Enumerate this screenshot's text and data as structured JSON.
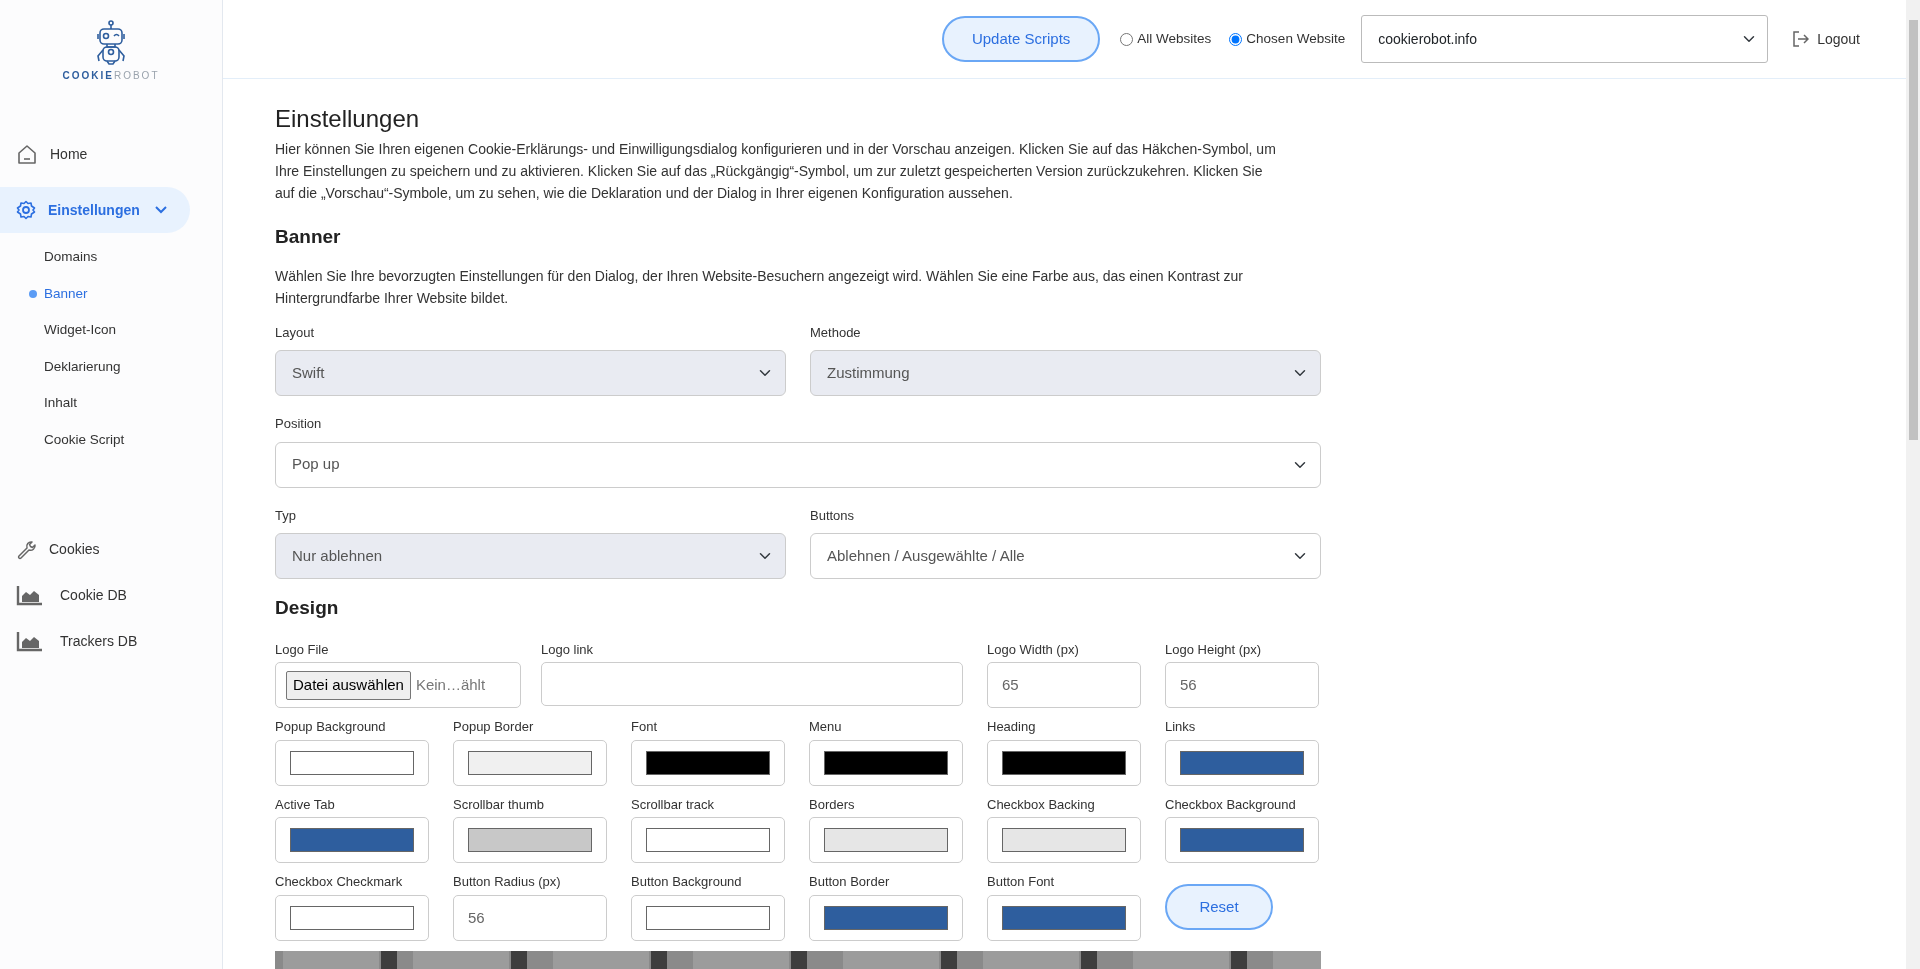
{
  "logo": {
    "bold_part": "COOKIE",
    "light_part": "ROBOT"
  },
  "sidebar": {
    "items": [
      {
        "label": "Home",
        "kind": "home",
        "selected": false
      },
      {
        "label": "Einstellungen",
        "kind": "settings",
        "selected": true,
        "expanded": true,
        "children": [
          {
            "label": "Domains",
            "selected": false
          },
          {
            "label": "Banner",
            "selected": true
          },
          {
            "label": "Widget-Icon",
            "selected": false
          },
          {
            "label": "Deklarierung",
            "selected": false
          },
          {
            "label": "Inhalt",
            "selected": false
          },
          {
            "label": "Cookie Script",
            "selected": false
          }
        ]
      },
      {
        "label": "Cookies",
        "kind": "wrench",
        "selected": false
      },
      {
        "label": "Cookie DB",
        "kind": "chart",
        "selected": false
      },
      {
        "label": "Trackers DB",
        "kind": "chart",
        "selected": false
      }
    ]
  },
  "topbar": {
    "update_button": "Update Scripts",
    "scope": [
      {
        "label": "All Websites",
        "selected": false
      },
      {
        "label": "Chosen Website",
        "selected": true
      }
    ],
    "website_select": {
      "value": "cookierobot.info"
    },
    "logout": "Logout"
  },
  "page": {
    "title": "Einstellungen",
    "intro": "Hier können Sie Ihren eigenen Cookie-Erklärungs- und Einwilligungsdialog konfigurieren und in der Vorschau anzeigen. Klicken Sie auf das Häkchen-Symbol, um Ihre Einstellungen zu speichern und zu aktivieren. Klicken Sie auf das „Rückgängig“-Symbol, um zur zuletzt gespeicherten Version zurückzukehren. Klicken Sie auf die „Vorschau“-Symbole, um zu sehen, wie die Deklaration und der Dialog in Ihrer eigenen Konfiguration aussehen.",
    "banner_heading": "Banner",
    "banner_text": "Wählen Sie Ihre bevorzugten Einstellungen für den Dialog, der Ihren Website-Besuchern angezeigt wird. Wählen Sie eine Farbe aus, das einen Kontrast zur Hintergrundfarbe Ihrer Website bildet.",
    "selects": [
      [
        {
          "label": "Layout",
          "value": "Swift",
          "disabled": true
        },
        {
          "label": "Methode",
          "value": "Zustimmung",
          "disabled": true
        }
      ],
      [
        {
          "label": "Position",
          "value": "Pop up",
          "disabled": false
        }
      ],
      [
        {
          "label": "Typ",
          "value": "Nur ablehnen",
          "disabled": true
        },
        {
          "label": "Buttons",
          "value": "Ablehnen / Ausgewählte / Alle",
          "disabled": false
        }
      ]
    ],
    "design_heading": "Design",
    "logo_file": {
      "label": "Logo File",
      "button": "Datei auswählen",
      "file_name": "Kein…ählt"
    },
    "logo_link": {
      "label": "Logo link"
    },
    "logo_size": [
      {
        "label": "Logo Width (px)",
        "value": "65"
      },
      {
        "label": "Logo Height (px)",
        "value": "56"
      }
    ],
    "design_fields": [
      {
        "label": "Popup Background",
        "kind": "color",
        "color": "#ffffff"
      },
      {
        "label": "Popup Border",
        "kind": "color",
        "color": "#f0f0f0"
      },
      {
        "label": "Font",
        "kind": "color",
        "color": "#000000"
      },
      {
        "label": "Menu",
        "kind": "color",
        "color": "#000000"
      },
      {
        "label": "Heading",
        "kind": "color",
        "color": "#000000"
      },
      {
        "label": "Links",
        "kind": "color",
        "color": "#2e5e9e"
      },
      {
        "label": "Active Tab",
        "kind": "color",
        "color": "#2e5e9e"
      },
      {
        "label": "Scrollbar thumb",
        "kind": "color",
        "color": "#c8c8c8"
      },
      {
        "label": "Scrollbar track",
        "kind": "color",
        "color": "#ffffff"
      },
      {
        "label": "Borders",
        "kind": "color",
        "color": "#e6e6e6"
      },
      {
        "label": "Checkbox Backing",
        "kind": "color",
        "color": "#e6e6e6"
      },
      {
        "label": "Checkbox Background",
        "kind": "color",
        "color": "#2e5e9e"
      },
      {
        "label": "Checkbox Checkmark",
        "kind": "color",
        "color": "#ffffff"
      },
      {
        "label": "Button Radius (px)",
        "kind": "number",
        "value": "56"
      },
      {
        "label": "Button Background",
        "kind": "color",
        "color": "#ffffff"
      },
      {
        "label": "Button Border",
        "kind": "color",
        "color": "#2e5e9e"
      },
      {
        "label": "Button Font",
        "kind": "color",
        "color": "#2e5e9e"
      },
      {
        "kind": "button",
        "label": "Reset"
      }
    ],
    "preview": {
      "kind": "picture"
    }
  }
}
